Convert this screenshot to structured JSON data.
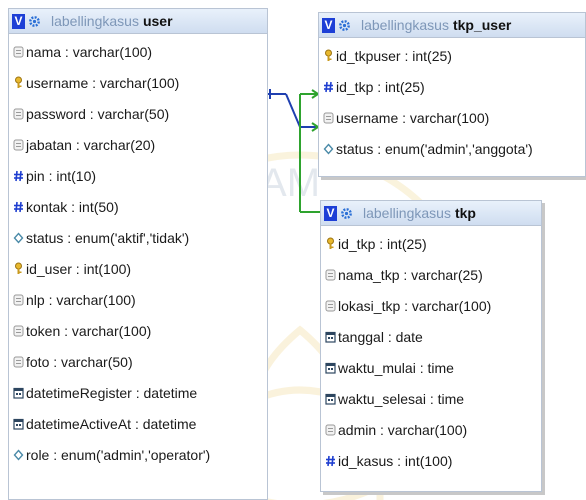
{
  "colors": {
    "header_top": "#e9f1fb",
    "header_bottom": "#cfddf0",
    "db_name": "#7e97b8",
    "relation_blue": "#1f3fb0",
    "relation_green": "#2ea32e",
    "watermark_gold": "#e9c766"
  },
  "watermark": {
    "text": "ISLAM"
  },
  "tables": [
    {
      "id": "user",
      "db": "labellingkasus",
      "name": "user",
      "header_icons": [
        "view-icon",
        "gear-icon"
      ],
      "columns": [
        {
          "text": "nama : varchar(100)",
          "icon": "field-icon"
        },
        {
          "text": "username : varchar(100)",
          "icon": "key-icon"
        },
        {
          "text": "password : varchar(50)",
          "icon": "field-icon"
        },
        {
          "text": "jabatan : varchar(20)",
          "icon": "field-icon"
        },
        {
          "text": "pin : int(10)",
          "icon": "hash-icon"
        },
        {
          "text": "kontak : int(50)",
          "icon": "hash-icon"
        },
        {
          "text": "status : enum('aktif','tidak')",
          "icon": "enum-icon"
        },
        {
          "text": "id_user : int(100)",
          "icon": "key-icon"
        },
        {
          "text": "nlp : varchar(100)",
          "icon": "field-icon"
        },
        {
          "text": "token : varchar(100)",
          "icon": "field-icon"
        },
        {
          "text": "foto : varchar(50)",
          "icon": "field-icon"
        },
        {
          "text": "datetimeRegister : datetime",
          "icon": "calendar-icon"
        },
        {
          "text": "datetimeActiveAt : datetime",
          "icon": "calendar-icon"
        },
        {
          "text": "role : enum('admin','operator')",
          "icon": "enum-icon"
        }
      ]
    },
    {
      "id": "tkp_user",
      "db": "labellingkasus",
      "name": "tkp_user",
      "header_icons": [
        "view-icon",
        "gear-icon"
      ],
      "columns": [
        {
          "text": "id_tkpuser : int(25)",
          "icon": "key-icon"
        },
        {
          "text": "id_tkp : int(25)",
          "icon": "hash-icon"
        },
        {
          "text": "username : varchar(100)",
          "icon": "field-icon"
        },
        {
          "text": "status : enum('admin','anggota')",
          "icon": "enum-icon"
        }
      ]
    },
    {
      "id": "tkp",
      "db": "labellingkasus",
      "name": "tkp",
      "header_icons": [
        "view-icon",
        "gear-icon"
      ],
      "columns": [
        {
          "text": "id_tkp : int(25)",
          "icon": "key-icon"
        },
        {
          "text": "nama_tkp : varchar(25)",
          "icon": "field-icon"
        },
        {
          "text": "lokasi_tkp : varchar(100)",
          "icon": "field-icon"
        },
        {
          "text": "tanggal : date",
          "icon": "calendar-icon"
        },
        {
          "text": "waktu_mulai : time",
          "icon": "calendar-icon"
        },
        {
          "text": "waktu_selesai : time",
          "icon": "calendar-icon"
        },
        {
          "text": "admin : varchar(100)",
          "icon": "field-icon"
        },
        {
          "text": "id_kasus : int(100)",
          "icon": "hash-icon"
        }
      ]
    }
  ]
}
